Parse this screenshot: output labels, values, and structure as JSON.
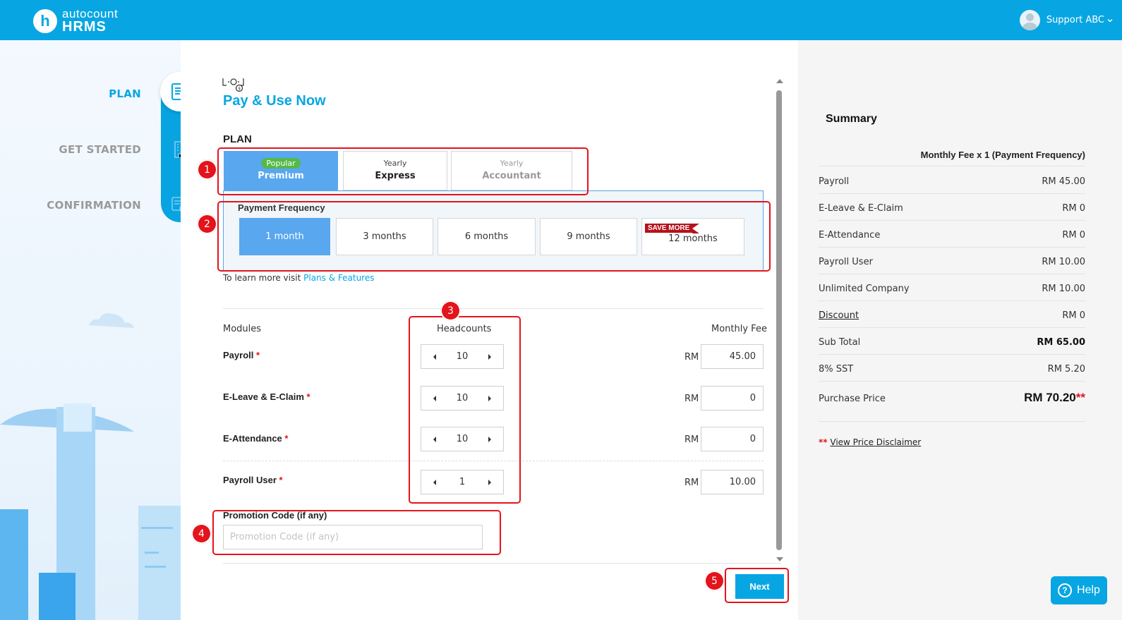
{
  "header": {
    "logo_top": "autocount",
    "logo_bottom": "HRMS",
    "logo_mark": "h",
    "user_name": "Support ABC"
  },
  "steps": [
    {
      "label": "PLAN",
      "state": "active",
      "icon": "plan-edit-icon"
    },
    {
      "label": "GET STARTED",
      "state": "inactive",
      "icon": "building-icon"
    },
    {
      "label": "CONFIRMATION",
      "state": "inactive",
      "icon": "confirmation-check-icon"
    }
  ],
  "page": {
    "title": "Pay & Use Now",
    "plan_section": "PLAN",
    "plans": [
      {
        "badge": "Popular",
        "name": "Premium",
        "state": "selected"
      },
      {
        "subtitle": "Yearly",
        "name": "Express",
        "state": "available"
      },
      {
        "subtitle": "Yearly",
        "name": "Accountant",
        "state": "disabled"
      }
    ],
    "frequency_label": "Payment Frequency",
    "frequencies": [
      "1 month",
      "3 months",
      "6 months",
      "9 months",
      "12 months"
    ],
    "frequency_selected": "1 month",
    "save_more": "SAVE MORE",
    "learn_prefix": "To learn more visit",
    "learn_link": "Plans & Features",
    "col_modules": "Modules",
    "col_headcounts": "Headcounts",
    "col_fee": "Monthly Fee",
    "currency": "RM",
    "modules": [
      {
        "name": "Payroll",
        "required": "*",
        "headcount": "10",
        "fee": "45.00"
      },
      {
        "name": "E-Leave & E-Claim",
        "required": "*",
        "headcount": "10",
        "fee": "0"
      },
      {
        "name": "E-Attendance",
        "required": "*",
        "headcount": "10",
        "fee": "0"
      },
      {
        "name": "Payroll User",
        "required": "*",
        "headcount": "1",
        "fee": "10.00"
      }
    ],
    "promo_label": "Promotion Code (if any)",
    "promo_placeholder": "Promotion Code (if any)",
    "promo_value": "",
    "next_label": "Next"
  },
  "annotations": [
    "1",
    "2",
    "3",
    "4",
    "5"
  ],
  "summary": {
    "title": "Summary",
    "header": "Monthly Fee x 1 (Payment Frequency)",
    "rows": [
      {
        "label": "Payroll",
        "value": "RM 45.00"
      },
      {
        "label": "E-Leave & E-Claim",
        "value": "RM 0"
      },
      {
        "label": "E-Attendance",
        "value": "RM 0"
      },
      {
        "label": "Payroll User",
        "value": "RM 10.00"
      },
      {
        "label": "Unlimited Company",
        "value": "RM 10.00"
      },
      {
        "label": "Discount",
        "value": "RM 0"
      },
      {
        "label": "Sub Total",
        "value": "RM 65.00"
      },
      {
        "label": "8% SST",
        "value": "RM 5.20"
      }
    ],
    "purchase_label": "Purchase Price",
    "purchase_value": "RM 70.20",
    "purchase_stars": "**",
    "disclaimer_stars": "**",
    "disclaimer_link": "View Price Disclaimer"
  },
  "help": {
    "label": "Help",
    "icon": "question-circle-icon"
  },
  "colors": {
    "brand": "#07a6e3",
    "selected": "#58a7ef",
    "annotation": "#e3141b",
    "badge": "#55b949",
    "save_more": "#b5121b"
  }
}
